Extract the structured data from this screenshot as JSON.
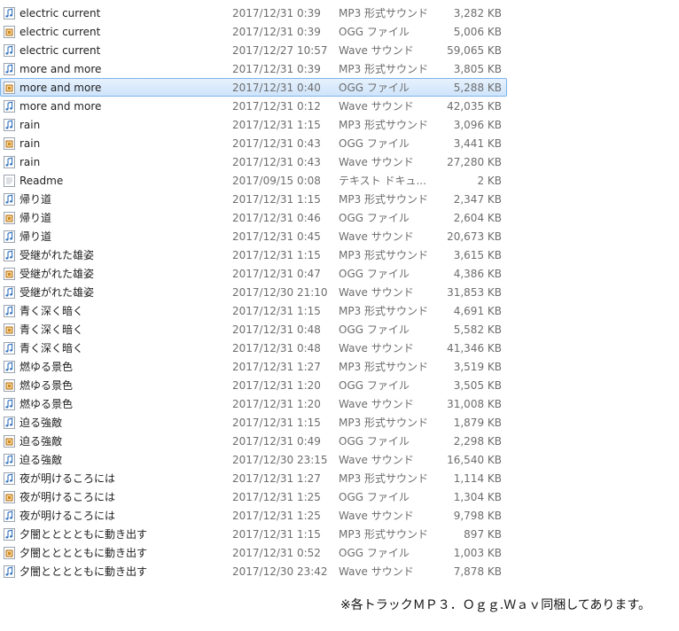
{
  "files": [
    {
      "name": "electric current",
      "date": "2017/12/31 0:39",
      "type": "MP3 形式サウンド",
      "size": "3,282 KB",
      "icon": "mp3-audio-icon"
    },
    {
      "name": "electric current",
      "date": "2017/12/31 0:39",
      "type": "OGG ファイル",
      "size": "5,006 KB",
      "icon": "ogg-file-icon"
    },
    {
      "name": "electric current",
      "date": "2017/12/27 10:57",
      "type": "Wave サウンド",
      "size": "59,065 KB",
      "icon": "wave-audio-icon"
    },
    {
      "name": "more and more",
      "date": "2017/12/31 0:39",
      "type": "MP3 形式サウンド",
      "size": "3,805 KB",
      "icon": "mp3-audio-icon"
    },
    {
      "name": "more and more",
      "date": "2017/12/31 0:40",
      "type": "OGG ファイル",
      "size": "5,288 KB",
      "icon": "ogg-file-icon",
      "selected": true
    },
    {
      "name": "more and more",
      "date": "2017/12/31 0:12",
      "type": "Wave サウンド",
      "size": "42,035 KB",
      "icon": "wave-audio-icon"
    },
    {
      "name": "rain",
      "date": "2017/12/31 1:15",
      "type": "MP3 形式サウンド",
      "size": "3,096 KB",
      "icon": "mp3-audio-icon"
    },
    {
      "name": "rain",
      "date": "2017/12/31 0:43",
      "type": "OGG ファイル",
      "size": "3,441 KB",
      "icon": "ogg-file-icon"
    },
    {
      "name": "rain",
      "date": "2017/12/31 0:43",
      "type": "Wave サウンド",
      "size": "27,280 KB",
      "icon": "wave-audio-icon"
    },
    {
      "name": "Readme",
      "date": "2017/09/15 0:08",
      "type": "テキスト ドキュ...",
      "size": "2 KB",
      "icon": "text-document-icon"
    },
    {
      "name": "帰り道",
      "date": "2017/12/31 1:15",
      "type": "MP3 形式サウンド",
      "size": "2,347 KB",
      "icon": "mp3-audio-icon"
    },
    {
      "name": "帰り道",
      "date": "2017/12/31 0:46",
      "type": "OGG ファイル",
      "size": "2,604 KB",
      "icon": "ogg-file-icon"
    },
    {
      "name": "帰り道",
      "date": "2017/12/31 0:45",
      "type": "Wave サウンド",
      "size": "20,673 KB",
      "icon": "wave-audio-icon"
    },
    {
      "name": "受継がれた雄姿",
      "date": "2017/12/31 1:15",
      "type": "MP3 形式サウンド",
      "size": "3,615 KB",
      "icon": "mp3-audio-icon"
    },
    {
      "name": "受継がれた雄姿",
      "date": "2017/12/31 0:47",
      "type": "OGG ファイル",
      "size": "4,386 KB",
      "icon": "ogg-file-icon"
    },
    {
      "name": "受継がれた雄姿",
      "date": "2017/12/30 21:10",
      "type": "Wave サウンド",
      "size": "31,853 KB",
      "icon": "wave-audio-icon"
    },
    {
      "name": "青く深く暗く",
      "date": "2017/12/31 1:15",
      "type": "MP3 形式サウンド",
      "size": "4,691 KB",
      "icon": "mp3-audio-icon"
    },
    {
      "name": "青く深く暗く",
      "date": "2017/12/31 0:48",
      "type": "OGG ファイル",
      "size": "5,582 KB",
      "icon": "ogg-file-icon"
    },
    {
      "name": "青く深く暗く",
      "date": "2017/12/31 0:48",
      "type": "Wave サウンド",
      "size": "41,346 KB",
      "icon": "wave-audio-icon"
    },
    {
      "name": "燃ゆる景色",
      "date": "2017/12/31 1:27",
      "type": "MP3 形式サウンド",
      "size": "3,519 KB",
      "icon": "mp3-audio-icon"
    },
    {
      "name": "燃ゆる景色",
      "date": "2017/12/31 1:20",
      "type": "OGG ファイル",
      "size": "3,505 KB",
      "icon": "ogg-file-icon"
    },
    {
      "name": "燃ゆる景色",
      "date": "2017/12/31 1:20",
      "type": "Wave サウンド",
      "size": "31,008 KB",
      "icon": "wave-audio-icon"
    },
    {
      "name": "迫る強敵",
      "date": "2017/12/31 1:15",
      "type": "MP3 形式サウンド",
      "size": "1,879 KB",
      "icon": "mp3-audio-icon"
    },
    {
      "name": "迫る強敵",
      "date": "2017/12/31 0:49",
      "type": "OGG ファイル",
      "size": "2,298 KB",
      "icon": "ogg-file-icon"
    },
    {
      "name": "迫る強敵",
      "date": "2017/12/30 23:15",
      "type": "Wave サウンド",
      "size": "16,540 KB",
      "icon": "wave-audio-icon"
    },
    {
      "name": "夜が明けるころには",
      "date": "2017/12/31 1:27",
      "type": "MP3 形式サウンド",
      "size": "1,114 KB",
      "icon": "mp3-audio-icon"
    },
    {
      "name": "夜が明けるころには",
      "date": "2017/12/31 1:25",
      "type": "OGG ファイル",
      "size": "1,304 KB",
      "icon": "ogg-file-icon"
    },
    {
      "name": "夜が明けるころには",
      "date": "2017/12/31 1:25",
      "type": "Wave サウンド",
      "size": "9,798 KB",
      "icon": "wave-audio-icon"
    },
    {
      "name": "夕闇とととともに動き出す",
      "date": "2017/12/31 1:15",
      "type": "MP3 形式サウンド",
      "size": "897 KB",
      "icon": "mp3-audio-icon"
    },
    {
      "name": "夕闇とととともに動き出す",
      "date": "2017/12/31 0:52",
      "type": "OGG ファイル",
      "size": "1,003 KB",
      "icon": "ogg-file-icon"
    },
    {
      "name": "夕闇とととともに動き出す",
      "date": "2017/12/30 23:42",
      "type": "Wave サウンド",
      "size": "7,878 KB",
      "icon": "wave-audio-icon"
    }
  ],
  "footer_note": "※各トラックＭＰ３．Ｏｇｇ.Ｗａｖ同梱してあります。",
  "colors": {
    "selection_bg": "#cfe4fb",
    "selection_border": "#7eb4ea",
    "music_note": "#2f6fbf",
    "ogg_badge": "#d08a1e",
    "secondary_text": "#6d6d6d"
  }
}
